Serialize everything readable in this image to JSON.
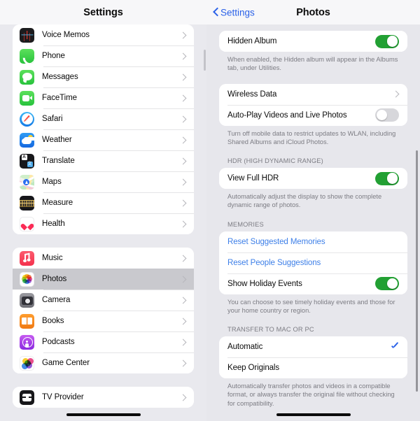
{
  "left_pane": {
    "navbar": {
      "title": "Settings"
    },
    "groups": [
      {
        "items": [
          {
            "label": "Voice Memos",
            "icon": "voice-memos-icon"
          },
          {
            "label": "Phone",
            "icon": "phone-icon"
          },
          {
            "label": "Messages",
            "icon": "messages-icon"
          },
          {
            "label": "FaceTime",
            "icon": "facetime-icon"
          },
          {
            "label": "Safari",
            "icon": "safari-icon"
          },
          {
            "label": "Weather",
            "icon": "weather-icon"
          },
          {
            "label": "Translate",
            "icon": "translate-icon"
          },
          {
            "label": "Maps",
            "icon": "maps-icon"
          },
          {
            "label": "Measure",
            "icon": "measure-icon"
          },
          {
            "label": "Health",
            "icon": "health-icon"
          }
        ]
      },
      {
        "items": [
          {
            "label": "Music",
            "icon": "music-icon"
          },
          {
            "label": "Photos",
            "icon": "photos-icon",
            "selected": true
          },
          {
            "label": "Camera",
            "icon": "camera-icon"
          },
          {
            "label": "Books",
            "icon": "books-icon"
          },
          {
            "label": "Podcasts",
            "icon": "podcasts-icon"
          },
          {
            "label": "Game Center",
            "icon": "game-center-icon"
          }
        ]
      },
      {
        "items": [
          {
            "label": "TV Provider",
            "icon": "tv-provider-icon"
          }
        ]
      }
    ]
  },
  "right_pane": {
    "navbar": {
      "back_label": "Settings",
      "title": "Photos"
    },
    "sections": [
      {
        "header": "",
        "rows": [
          {
            "label": "Hidden Album",
            "control": "toggle",
            "value": "on"
          }
        ],
        "footnote": "When enabled, the Hidden album will appear in the Albums tab, under Utilities."
      },
      {
        "header": "",
        "rows": [
          {
            "label": "Wireless Data",
            "control": "chevron"
          },
          {
            "label": "Auto-Play Videos and Live Photos",
            "control": "toggle",
            "value": "off"
          }
        ],
        "footnote": "Turn off mobile data to restrict updates to WLAN, including Shared Albums and iCloud Photos."
      },
      {
        "header": "HDR (HIGH DYNAMIC RANGE)",
        "rows": [
          {
            "label": "View Full HDR",
            "control": "toggle",
            "value": "on"
          }
        ],
        "footnote": "Automatically adjust the display to show the complete dynamic range of photos."
      },
      {
        "header": "MEMORIES",
        "rows": [
          {
            "label": "Reset Suggested Memories",
            "control": "link"
          },
          {
            "label": "Reset People Suggestions",
            "control": "link"
          },
          {
            "label": "Show Holiday Events",
            "control": "toggle",
            "value": "on"
          }
        ],
        "footnote": "You can choose to see timely holiday events and those for your home country or region."
      },
      {
        "header": "TRANSFER TO MAC OR PC",
        "rows": [
          {
            "label": "Automatic",
            "control": "check",
            "value": "checked"
          },
          {
            "label": "Keep Originals",
            "control": "none"
          }
        ],
        "footnote": "Automatically transfer photos and videos in a compatible format, or always transfer the original file without checking for compatibility."
      }
    ]
  },
  "colors": {
    "accent_blue": "#2a61e8",
    "link_blue": "#3d7fe8",
    "toggle_on_green": "#22a033",
    "toggle_off_gray": "#d7d7db",
    "page_background": "#e7e7ec",
    "card_background": "#ffffff",
    "selected_row": "#c9c9ce"
  }
}
